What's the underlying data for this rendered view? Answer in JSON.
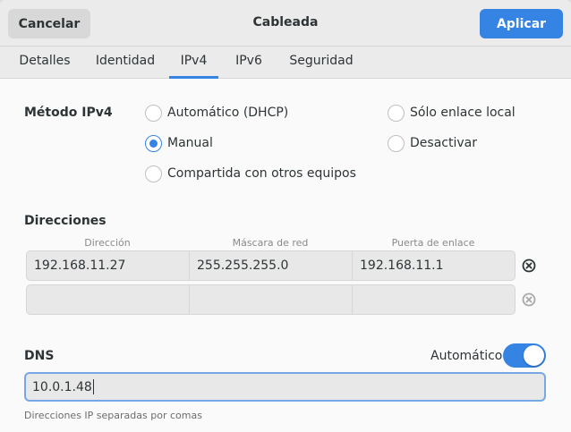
{
  "header": {
    "title": "Cableada",
    "cancel_label": "Cancelar",
    "apply_label": "Aplicar"
  },
  "tabs": [
    {
      "label": "Detalles",
      "active": false
    },
    {
      "label": "Identidad",
      "active": false
    },
    {
      "label": "IPv4",
      "active": true
    },
    {
      "label": "IPv6",
      "active": false
    },
    {
      "label": "Seguridad",
      "active": false
    }
  ],
  "method": {
    "label": "Método IPv4",
    "options": [
      {
        "label": "Automático (DHCP)",
        "checked": false
      },
      {
        "label": "Sólo enlace local",
        "checked": false
      },
      {
        "label": "Manual",
        "checked": true
      },
      {
        "label": "Desactivar",
        "checked": false
      },
      {
        "label": "Compartida con otros equipos",
        "checked": false
      }
    ]
  },
  "addresses": {
    "label": "Direcciones",
    "columns": [
      "Dirección",
      "Máscara de red",
      "Puerta de enlace"
    ],
    "rows": [
      {
        "address": "192.168.11.27",
        "netmask": "255.255.255.0",
        "gateway": "192.168.11.1"
      },
      {
        "address": "",
        "netmask": "",
        "gateway": ""
      }
    ]
  },
  "dns": {
    "label": "DNS",
    "auto_label": "Automático",
    "auto_enabled": true,
    "value": "10.0.1.48",
    "hint": "Direcciones IP separadas por comas"
  },
  "colors": {
    "accent": "#3584e4",
    "header_bg": "#ebebeb",
    "content_bg": "#fafafa"
  }
}
